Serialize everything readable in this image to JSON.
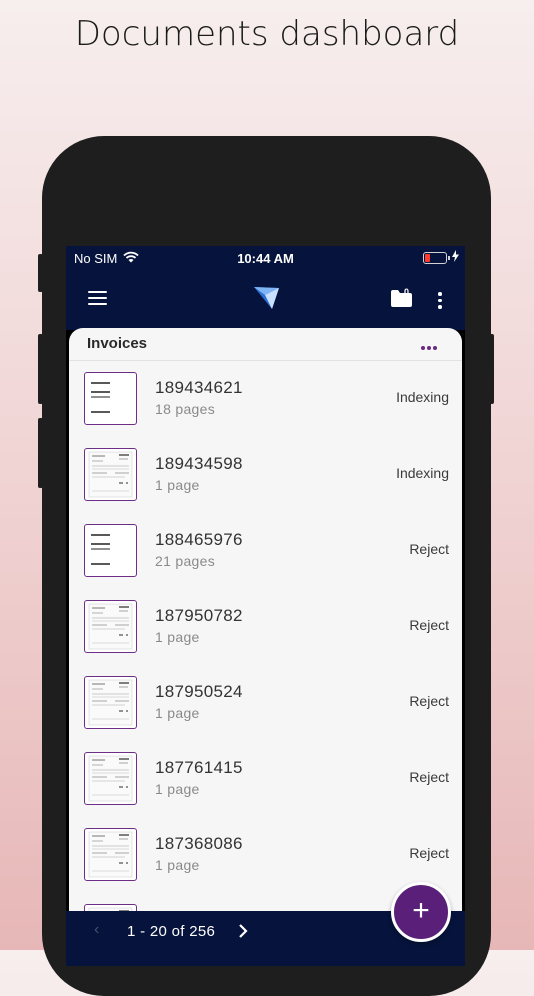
{
  "headline": "Documents dashboard",
  "statusbar": {
    "carrier": "No SIM",
    "time": "10:44 AM"
  },
  "appbar": {
    "notification_count": "0"
  },
  "list": {
    "title": "Invoices",
    "rows": [
      {
        "id": "189434621",
        "pages": "18 pages",
        "status": "Indexing",
        "thumb": "lines"
      },
      {
        "id": "189434598",
        "pages": "1 page",
        "status": "Indexing",
        "thumb": "invoice"
      },
      {
        "id": "188465976",
        "pages": "21 pages",
        "status": "Reject",
        "thumb": "lines"
      },
      {
        "id": "187950782",
        "pages": "1 page",
        "status": "Reject",
        "thumb": "invoice"
      },
      {
        "id": "187950524",
        "pages": "1 page",
        "status": "Reject",
        "thumb": "invoice"
      },
      {
        "id": "187761415",
        "pages": "1 page",
        "status": "Reject",
        "thumb": "invoice"
      },
      {
        "id": "187368086",
        "pages": "1 page",
        "status": "Reject",
        "thumb": "invoice"
      }
    ]
  },
  "pager": {
    "range": "1 - 20 of 256"
  },
  "fab_label": "+",
  "colors": {
    "navy": "#06133c",
    "purple": "#5a1f79",
    "accent_border": "#6d2f86"
  }
}
